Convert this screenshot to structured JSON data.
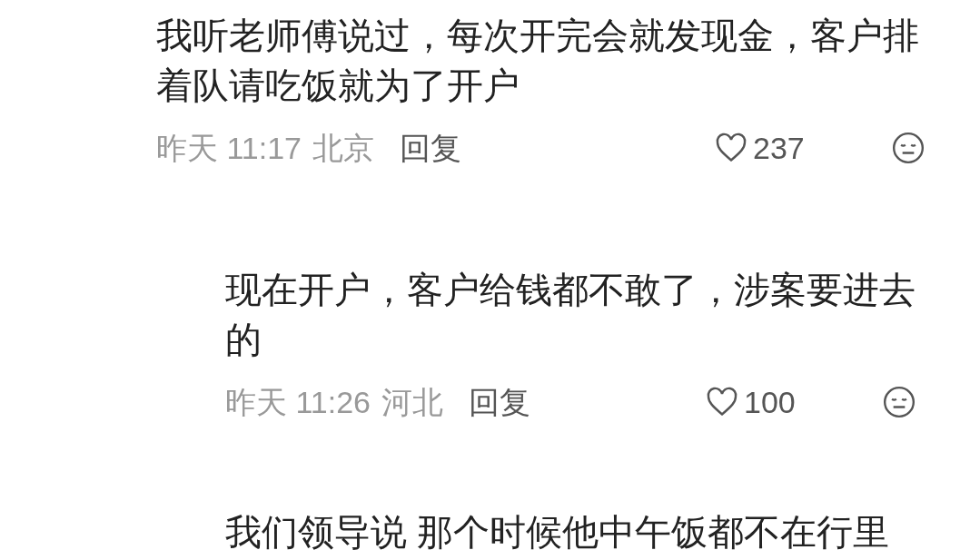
{
  "comments": [
    {
      "text": "我听老师傅说过，每次开完会就发现金，客户排着队请吃饭就为了开户",
      "time": "昨天 11:17",
      "location": "北京",
      "reply": "回复",
      "likes": "237",
      "reply_level": false
    },
    {
      "text": "现在开户，客户给钱都不敢了，涉案要进去的",
      "time": "昨天 11:26",
      "location": "河北",
      "reply": "回复",
      "likes": "100",
      "reply_level": true
    },
    {
      "text": "我们领导说 那个时候他中午饭都不在行里",
      "reply_level": true
    }
  ]
}
